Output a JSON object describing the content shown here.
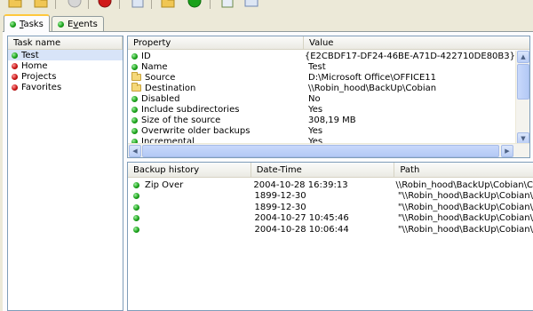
{
  "toolbar": {
    "buttons": [
      {
        "icon": "open-folder-icon",
        "color": "#e8b84a"
      },
      {
        "icon": "folder-icon",
        "color": "#e8b84a"
      },
      {
        "icon": "disabled-circle-icon",
        "color": "#b8b8b8"
      },
      {
        "icon": "stop-icon",
        "color": "#d01818"
      },
      {
        "icon": "document-icon",
        "color": "#c8d4e8"
      },
      {
        "icon": "folder-icon",
        "color": "#e8b84a"
      },
      {
        "icon": "run-icon",
        "color": "#1a9a1a"
      },
      {
        "icon": "properties-icon",
        "color": "#6a8a4a"
      },
      {
        "icon": "window-icon",
        "color": "#c8d4e8"
      }
    ]
  },
  "tabs": [
    {
      "label_underlined": "T",
      "label_rest": "asks",
      "icon": "green",
      "active": true
    },
    {
      "label_pre": "E",
      "label_underlined": "v",
      "label_rest": "ents",
      "icon": "green",
      "active": false
    }
  ],
  "tasks": {
    "header": "Task name",
    "items": [
      {
        "label": "Test",
        "icon": "green",
        "selected": true
      },
      {
        "label": "Home",
        "icon": "red",
        "selected": false
      },
      {
        "label": "Projects",
        "icon": "red",
        "selected": false
      },
      {
        "label": "Favorites",
        "icon": "red",
        "selected": false
      }
    ]
  },
  "properties": {
    "headers": {
      "property": "Property",
      "value": "Value"
    },
    "rows": [
      {
        "name": "ID",
        "value": "{E2CBDF17-DF24-46BE-A71D-422710DE80B3}",
        "icon": "green"
      },
      {
        "name": "Name",
        "value": "Test",
        "icon": "green"
      },
      {
        "name": "Source",
        "value": "D:\\Microsoft Office\\OFFICE11",
        "icon": "folder"
      },
      {
        "name": "Destination",
        "value": "\\\\Robin_hood\\BackUp\\Cobian",
        "icon": "folder"
      },
      {
        "name": "Disabled",
        "value": "No",
        "icon": "green"
      },
      {
        "name": "Include subdirectories",
        "value": "Yes",
        "icon": "green"
      },
      {
        "name": "Size of the source",
        "value": "308,19 MB",
        "icon": "green"
      },
      {
        "name": "Overwrite older backups",
        "value": "Yes",
        "icon": "green"
      },
      {
        "name": "Incremental",
        "value": "Yes",
        "icon": "green"
      }
    ]
  },
  "history": {
    "headers": {
      "backup": "Backup history",
      "datetime": "Date-Time",
      "path": "Path"
    },
    "rows": [
      {
        "name": "Zip Over",
        "datetime": "2004-10-28 16:39:13",
        "path": "\\\\Robin_hood\\BackUp\\Cobian\\C"
      },
      {
        "name": "",
        "datetime": "1899-12-30",
        "path": "\"\\\\Robin_hood\\BackUp\\Cobian\\"
      },
      {
        "name": "",
        "datetime": "1899-12-30",
        "path": "\"\\\\Robin_hood\\BackUp\\Cobian\\"
      },
      {
        "name": "",
        "datetime": "2004-10-27 10:45:46",
        "path": "\"\\\\Robin_hood\\BackUp\\Cobian\\"
      },
      {
        "name": "",
        "datetime": "2004-10-28 10:06:44",
        "path": "\"\\\\Robin_hood\\BackUp\\Cobian\\"
      }
    ]
  }
}
